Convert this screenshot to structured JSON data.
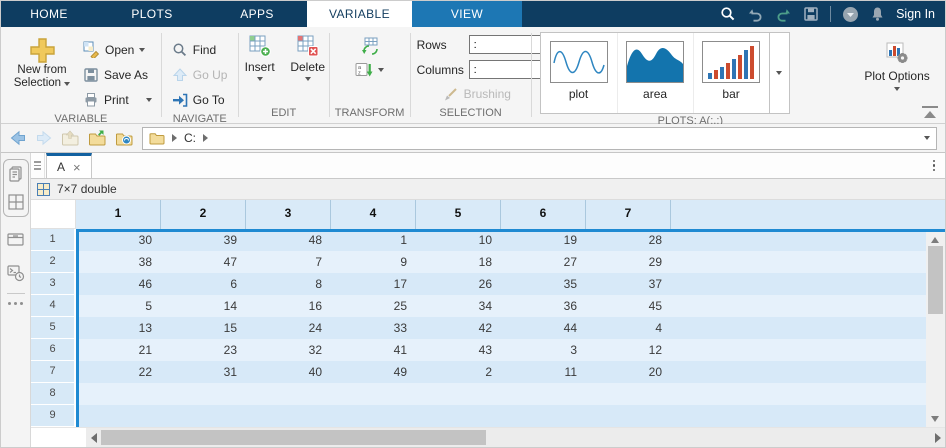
{
  "topbar": {
    "tabs": {
      "home": "HOME",
      "plots": "PLOTS",
      "apps": "APPS",
      "variable": "VARIABLE",
      "view": "VIEW"
    },
    "sign_in": "Sign In"
  },
  "ribbon": {
    "variable_section": {
      "label": "VARIABLE",
      "new_from_line1": "New from",
      "new_from_line2": "Selection",
      "open": "Open",
      "save_as": "Save As",
      "print": "Print"
    },
    "navigate_section": {
      "label": "NAVIGATE",
      "find": "Find",
      "go_up": "Go Up",
      "go_to": "Go To"
    },
    "edit_section": {
      "label": "EDIT",
      "insert": "Insert",
      "delete": "Delete"
    },
    "transform_section": {
      "label": "TRANSFORM"
    },
    "selection_section": {
      "label": "SELECTION",
      "rows_label": "Rows",
      "rows_value": ":",
      "columns_label": "Columns",
      "columns_value": ":",
      "brushing": "Brushing"
    },
    "plots_section": {
      "label": "PLOTS: A(:,:)",
      "items": [
        "plot",
        "area",
        "bar"
      ],
      "plot_options": "Plot Options"
    }
  },
  "addressbar": {
    "drive": "C:"
  },
  "editor": {
    "tab": {
      "title": "A",
      "close": "×"
    },
    "type_info": "7×7 double",
    "grid": {
      "col_headers": [
        "1",
        "2",
        "3",
        "4",
        "5",
        "6",
        "7"
      ],
      "row_headers": [
        "1",
        "2",
        "3",
        "4",
        "5",
        "6",
        "7",
        "8",
        "9"
      ],
      "data": [
        [
          30,
          39,
          48,
          1,
          10,
          19,
          28
        ],
        [
          38,
          47,
          7,
          9,
          18,
          27,
          29
        ],
        [
          46,
          6,
          8,
          17,
          26,
          35,
          37
        ],
        [
          5,
          14,
          16,
          25,
          34,
          36,
          45
        ],
        [
          13,
          15,
          24,
          33,
          42,
          44,
          4
        ],
        [
          21,
          23,
          32,
          41,
          43,
          3,
          12
        ],
        [
          22,
          31,
          40,
          49,
          2,
          11,
          20
        ]
      ]
    }
  },
  "icons": {
    "search": "magnifier",
    "undo": "curved-arrow-left",
    "redo": "curved-arrow-right",
    "save": "floppy-disk",
    "account": "circle-chevron-down",
    "notifications": "bell",
    "new_from_selection": "gold-plus",
    "open": "grid-with-pencil",
    "save_as": "floppy-disk",
    "print": "printer",
    "find": "magnifier",
    "go_up": "arrow-up",
    "go_to": "arrow-into-bracket",
    "insert": "grid-green-plus",
    "delete": "grid-red-x",
    "transpose": "grid-refresh-arrows",
    "sort": "sort-az-down",
    "brushing": "paint-brush",
    "plot": "sine-wave",
    "area": "filled-area-chart",
    "bar": "bar-chart",
    "plot_options": "bar-chart-gear",
    "collapse_ribbon": "chevron-up-with-bar",
    "back": "arrow-left",
    "forward": "arrow-right",
    "up_one_level": "folder-up",
    "browse_folder": "folder-green-arrow",
    "cloud_folder": "folder-blue-badge",
    "address_folder": "folder",
    "variable_type": "yellow-grid",
    "tab_menu": "hamburger",
    "doc_menu": "vertical-ellipsis",
    "panel_documents": "stacked-pages",
    "panel_variables": "grid",
    "panel_tray": "tray",
    "panel_history": "terminal-clock",
    "panel_more": "ellipsis"
  },
  "colors": {
    "topbar_navy": "#0e3d61",
    "contextual_blue": "#1d77b4",
    "active_tab_border": "#1261a0",
    "selection_border": "#1f8ad2",
    "header_cell": "#d9eaf8",
    "row_odd": "#d7e9f8",
    "row_even": "#e6f1fb",
    "plot_blue": "#2e86c1",
    "bar_red": "#cc4b2e",
    "gold_plus": "#f0c95c"
  }
}
